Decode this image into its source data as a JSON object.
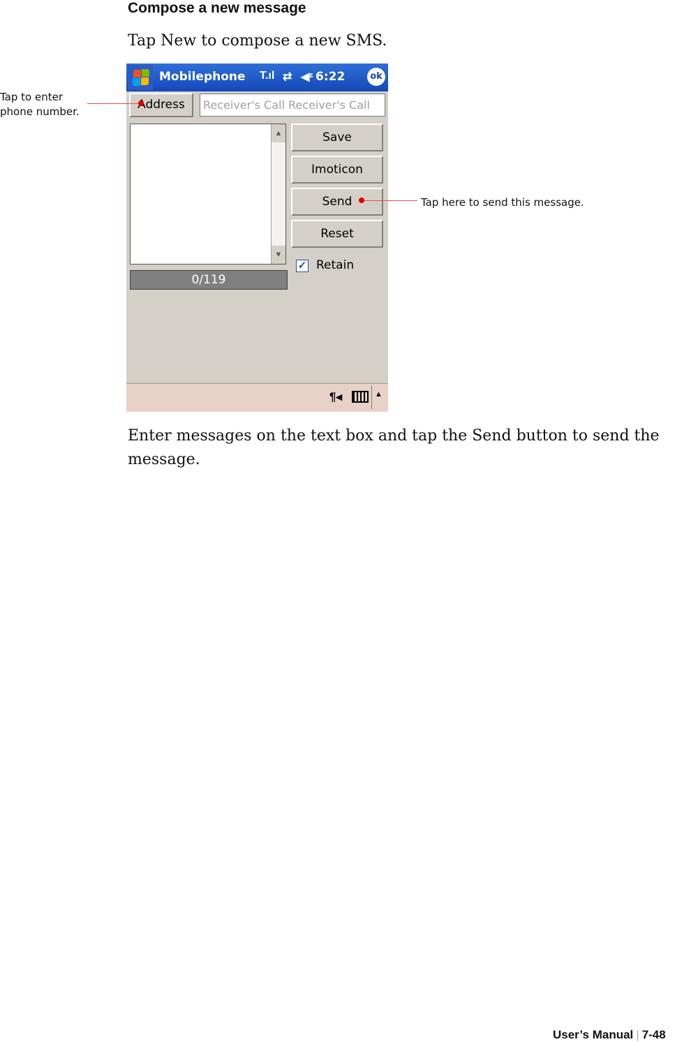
{
  "heading": "Compose a new message",
  "intro": "Tap New to compose a new SMS.",
  "callouts": {
    "address": "Tap to enter phone number.",
    "send": "Tap here to send this message."
  },
  "device": {
    "app_title": "Mobilephone",
    "time": "6:22",
    "ok_label": "ok",
    "address_button": "Address",
    "receiver_field": "Receiver's Call Receiver's Call",
    "buttons": {
      "save": "Save",
      "imoticon": "Imoticon",
      "send": "Send",
      "reset": "Reset"
    },
    "char_counter": "0/119",
    "retain_label": "Retain",
    "retain_checked": true,
    "icons": [
      "windows-start-icon",
      "signal-icon",
      "sync-icon",
      "speaker-icon",
      "paragraph-icon",
      "keyboard-icon",
      "arrow-up-icon"
    ]
  },
  "instruction": "Enter messages on the text box and tap the Send button to send the message.",
  "footer": {
    "manual": "User’s Manual",
    "page": "7-48"
  },
  "colors": {
    "titlebar": "#1448b8",
    "callout_line": "#e05050",
    "callout_dot": "#e00000"
  }
}
